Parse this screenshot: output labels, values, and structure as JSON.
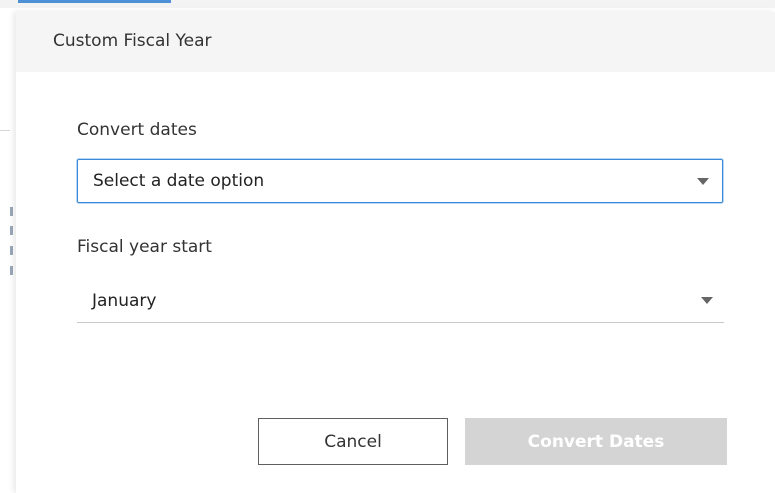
{
  "dialog": {
    "title": "Custom Fiscal Year"
  },
  "convert_dates": {
    "label": "Convert dates",
    "selected": "Select a date option"
  },
  "fiscal_year_start": {
    "label": "Fiscal year start",
    "selected": "January"
  },
  "actions": {
    "cancel_label": "Cancel",
    "convert_label": "Convert Dates",
    "convert_enabled": false
  },
  "colors": {
    "focus_border": "#3b8ad9",
    "disabled_button": "#d4d4d4",
    "header_bg": "#f5f5f5"
  },
  "icons": {
    "dropdown": "caret-down-icon"
  }
}
